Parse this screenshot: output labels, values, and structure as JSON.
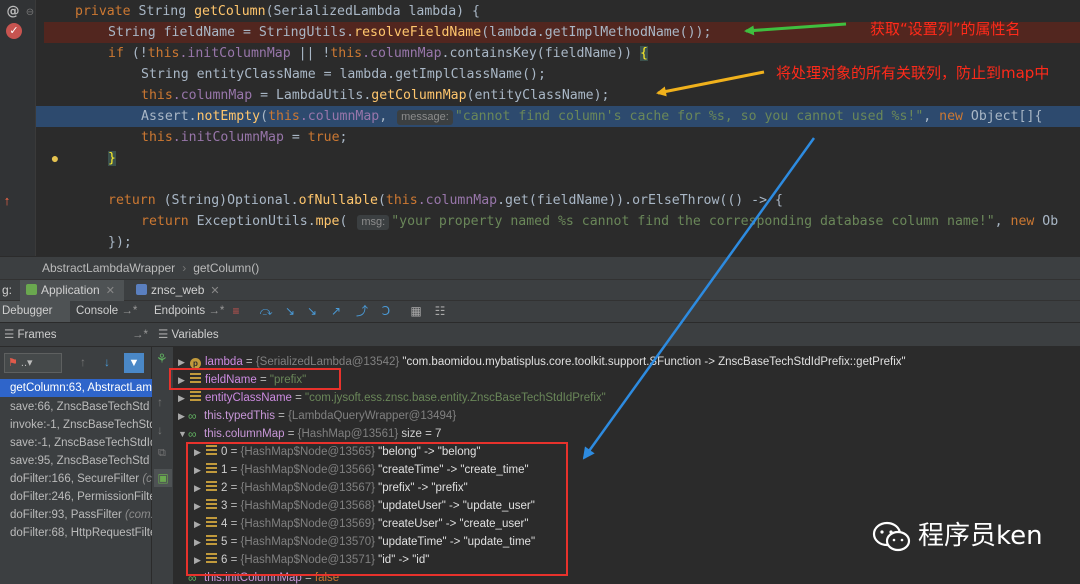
{
  "editor": {
    "lines": [
      {
        "kw1": "private ",
        "t1": "String ",
        "fn": "getColumn",
        "t2": "(SerializedLambda lambda) {"
      },
      {
        "t1": "String fieldName = StringUtils.",
        "fn": "resolveFieldName",
        "t2": "(lambda.getImplMethodName());"
      },
      {
        "kw1": "if ",
        "t1": "(!",
        "kw2": "this",
        "f1": ".initColumnMap",
        "t2": " || !",
        "kw3": "this",
        "f2": ".columnMap",
        "t3": ".containsKey(fieldName)) ",
        "br": "{"
      },
      {
        "t1": "String entityClassName = lambda.getImplClassName();"
      },
      {
        "kw1": "this",
        "f1": ".columnMap",
        "t1": " = LambdaUtils.",
        "fn": "getColumnMap",
        "t2": "(entityClassName);"
      },
      {
        "t1": "Assert.",
        "fn": "notEmpty",
        "t2": "(",
        "kw1": "this",
        "f1": ".columnMap",
        "t3": ", ",
        "hint": "message:",
        "s1": "\"cannot find column's cache for %s, so you cannot used %s!\"",
        "t4": ", ",
        "kw2": "new ",
        "t5": "Object[]{"
      },
      {
        "kw1": "this",
        "f1": ".initColumnMap",
        "t1": " = ",
        "kw2": "true",
        "t2": ";"
      },
      {
        "br": "}"
      },
      {
        "kw1": "return ",
        "t1": "(String)Optional.",
        "fn": "ofNullable",
        "t2": "(",
        "kw2": "this",
        "f1": ".columnMap",
        "t3": ".get(fieldName)).orElseThrow(() -> {"
      },
      {
        "kw1": "return ",
        "t1": "ExceptionUtils.",
        "fn": "mpe",
        "t2": "( ",
        "hint": "msg:",
        "s1": "\"your property named %s cannot find the corresponding database column name!\"",
        "t3": ", ",
        "kw2": "new ",
        "t4": "Ob"
      },
      {
        "t1": "});"
      }
    ],
    "annotations": {
      "a1": "获取“设置列”的属性名",
      "a2": "将处理对象的所有关联列，防止到map中"
    }
  },
  "breadcrumb": [
    "AbstractLambdaWrapper",
    "getColumn()"
  ],
  "runtabs": {
    "prefix": "g:",
    "app": "Application",
    "web": "znsc_web"
  },
  "debugbar": {
    "debugger": "Debugger",
    "console": "Console",
    "endpoints": "Endpoints"
  },
  "panels": {
    "frames": "Frames",
    "variables": "Variables"
  },
  "frames": [
    {
      "label": "getColumn:63, AbstractLam"
    },
    {
      "label": "save:66, ZnscBaseTechStd"
    },
    {
      "label": "invoke:-1, ZnscBaseTechStd"
    },
    {
      "label": "save:-1, ZnscBaseTechStdId"
    },
    {
      "label": "save:95, ZnscBaseTechStd"
    },
    {
      "label": "doFilter:166, SecureFilter ",
      "extra": "(co"
    },
    {
      "label": "doFilter:246, PermissionFilte"
    },
    {
      "label": "doFilter:93, PassFilter ",
      "extra": "(com."
    },
    {
      "label": "doFilter:68, HttpRequestFilte"
    }
  ],
  "variables": {
    "lambda": {
      "name": "lambda",
      "ref": "{SerializedLambda@13542}",
      "val": "\"com.baomidou.mybatisplus.core.toolkit.support.SFunction -> ZnscBaseTechStdIdPrefix::getPrefix\""
    },
    "fieldName": {
      "name": "fieldName",
      "val": "\"prefix\""
    },
    "entityClassName": {
      "name": "entityClassName",
      "val": "\"com.jysoft.ess.znsc.base.entity.ZnscBaseTechStdIdPrefix\""
    },
    "typedThis": {
      "name": "this.typedThis",
      "ref": "{LambdaQueryWrapper@13494}"
    },
    "columnMap": {
      "name": "this.columnMap",
      "ref": "{HashMap@13561}",
      "size": "size = 7"
    },
    "entries": [
      {
        "idx": "0",
        "ref": "{HashMap$Node@13565}",
        "val": "\"belong\" -> \"belong\""
      },
      {
        "idx": "1",
        "ref": "{HashMap$Node@13566}",
        "val": "\"createTime\" -> \"create_time\""
      },
      {
        "idx": "2",
        "ref": "{HashMap$Node@13567}",
        "val": "\"prefix\" -> \"prefix\""
      },
      {
        "idx": "3",
        "ref": "{HashMap$Node@13568}",
        "val": "\"updateUser\" -> \"update_user\""
      },
      {
        "idx": "4",
        "ref": "{HashMap$Node@13569}",
        "val": "\"createUser\" -> \"create_user\""
      },
      {
        "idx": "5",
        "ref": "{HashMap$Node@13570}",
        "val": "\"updateTime\" -> \"update_time\""
      },
      {
        "idx": "6",
        "ref": "{HashMap$Node@13571}",
        "val": "\"id\" -> \"id\""
      }
    ],
    "initColumnMap": {
      "name": "this.initColumnMap",
      "val": "false"
    }
  },
  "watermark": "程序员ken"
}
